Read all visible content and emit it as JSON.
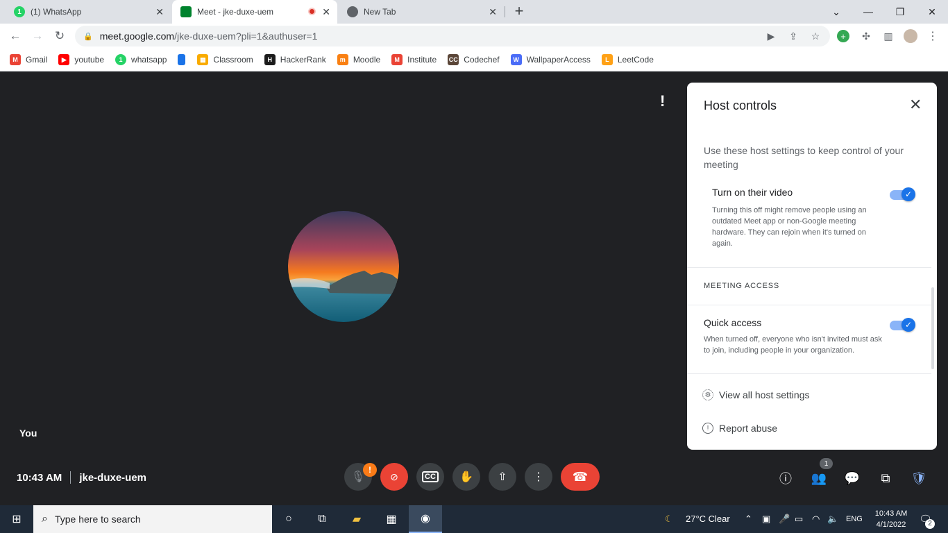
{
  "browser": {
    "tabs": [
      {
        "title": "(1) WhatsApp",
        "active": false
      },
      {
        "title": "Meet - jke-duxe-uem",
        "active": true
      },
      {
        "title": "New Tab",
        "active": false
      }
    ],
    "new_tab": "+",
    "url_main": "meet.google.com",
    "url_path": "/jke-duxe-uem?pli=1&authuser=1",
    "bookmarks": [
      {
        "label": "Gmail",
        "icon": "gmail-icon",
        "color": "#ea4335"
      },
      {
        "label": "youtube",
        "icon": "youtube-icon",
        "color": "#ff0000"
      },
      {
        "label": "whatsapp",
        "icon": "whatsapp-icon",
        "color": "#25d366"
      },
      {
        "label": "",
        "icon": "bookmark-doc-icon",
        "color": "#1a73e8"
      },
      {
        "label": "Classroom",
        "icon": "classroom-icon",
        "color": "#f9ab00"
      },
      {
        "label": "HackerRank",
        "icon": "hackerrank-icon",
        "color": "#1c1c1c"
      },
      {
        "label": "Moodle",
        "icon": "moodle-icon",
        "color": "#f98012"
      },
      {
        "label": "Institute",
        "icon": "gmail-icon",
        "color": "#ea4335"
      },
      {
        "label": "Codechef",
        "icon": "codechef-icon",
        "color": "#5b4638"
      },
      {
        "label": "WallpaperAccess",
        "icon": "wallpaperaccess-icon",
        "color": "#4a6cf7"
      },
      {
        "label": "LeetCode",
        "icon": "leetcode-icon",
        "color": "#ffa116"
      }
    ]
  },
  "meet": {
    "self_label": "You",
    "time": "10:43 AM",
    "meeting_code": "jke-duxe-uem",
    "people_count": "1",
    "mic_warning": "!"
  },
  "host_controls": {
    "title": "Host controls",
    "description": "Use these host settings to keep control of your meeting",
    "video_title": "Turn on their video",
    "video_desc": "Turning this off might remove people using an outdated Meet app or non-Google meeting hardware. They can rejoin when it's turned on again.",
    "section_access": "MEETING ACCESS",
    "quick_title": "Quick access",
    "quick_desc": "When turned off, everyone who isn't invited must ask to join, including people in your organization.",
    "view_all": "View all host settings",
    "report": "Report abuse"
  },
  "taskbar": {
    "search_placeholder": "Type here to search",
    "weather": "27°C  Clear",
    "lang": "ENG",
    "clock_time": "10:43 AM",
    "clock_date": "4/1/2022",
    "notif_count": "2"
  },
  "colors": {
    "meet_bg": "#202124",
    "accent_blue": "#1a73e8",
    "hangup_red": "#ea4335"
  }
}
